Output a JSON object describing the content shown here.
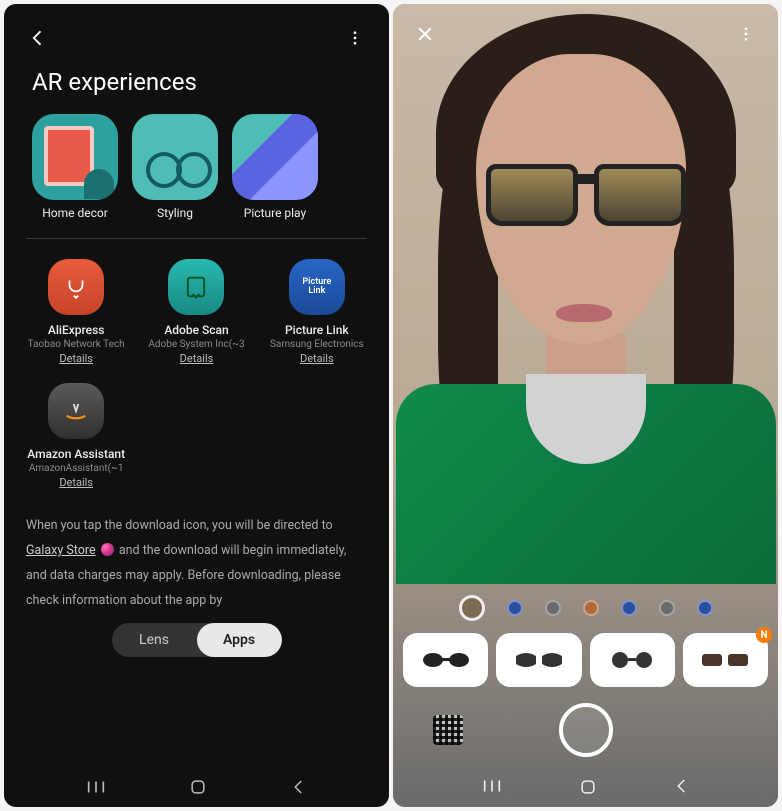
{
  "left": {
    "title": "AR experiences",
    "ar_items": [
      {
        "label": "Home decor"
      },
      {
        "label": "Styling"
      },
      {
        "label": "Picture play"
      }
    ],
    "apps": [
      {
        "name": "AliExpress",
        "subtitle": "Taobao Network Tech",
        "details": "Details"
      },
      {
        "name": "Adobe Scan",
        "subtitle": "Adobe System Inc(~3",
        "details": "Details"
      },
      {
        "name": "Picture Link",
        "subtitle": "Samsung Electronics",
        "details": "Details"
      },
      {
        "name": "Amazon Assistant",
        "subtitle": "AmazonAssistant(~1",
        "details": "Details"
      }
    ],
    "info_prefix": "When you tap the download icon, you will be directed to ",
    "info_store_link": "Galaxy Store",
    "info_suffix": " and the download will begin immediately, and data charges may apply. Before downloading, please check information about the app by",
    "tabs": {
      "lens": "Lens",
      "apps": "Apps"
    }
  },
  "right": {
    "color_dots": [
      {
        "c": "#7a6a56",
        "selected": true
      },
      {
        "c": "#2b4ea0",
        "selected": false
      },
      {
        "c": "#6a6a6a",
        "selected": false
      },
      {
        "c": "#b06a3a",
        "selected": false
      },
      {
        "c": "#2b4ea0",
        "selected": false
      },
      {
        "c": "#6a6a6a",
        "selected": false
      },
      {
        "c": "#2b4ea0",
        "selected": false
      }
    ],
    "frames": [
      {
        "badge": ""
      },
      {
        "badge": ""
      },
      {
        "badge": ""
      },
      {
        "badge": "N"
      }
    ]
  }
}
